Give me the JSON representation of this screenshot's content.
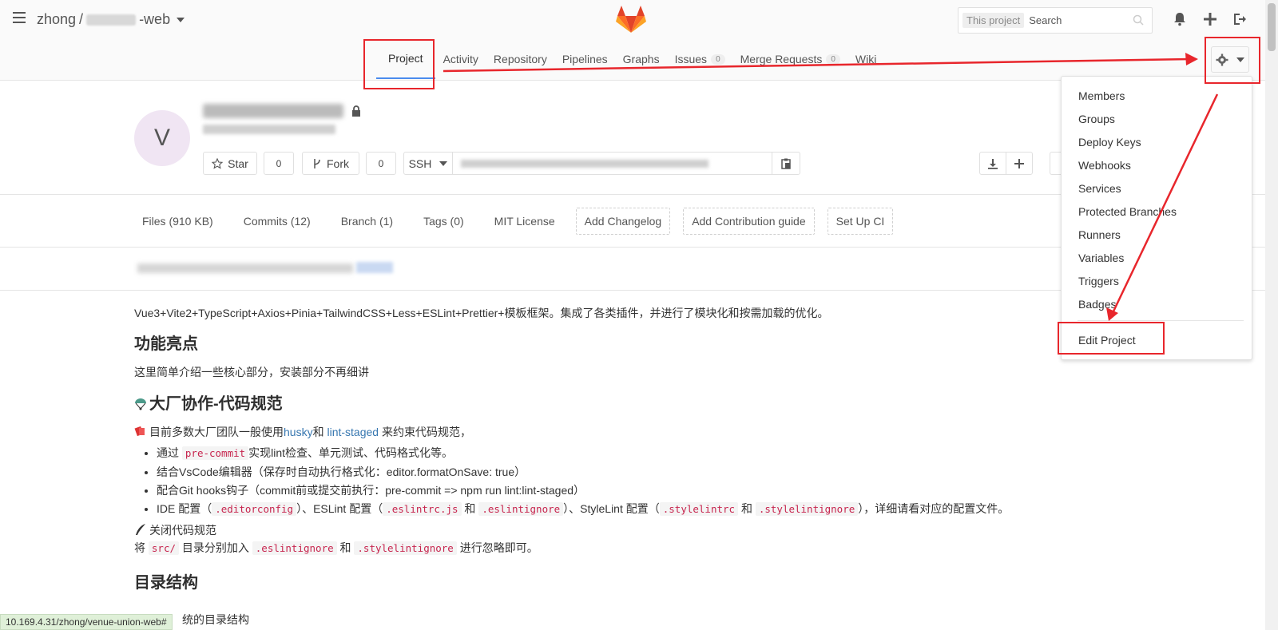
{
  "header": {
    "breadcrumb_user": "zhong",
    "breadcrumb_separator": "/",
    "breadcrumb_project_suffix": "-web",
    "search_scope": "This project",
    "search_placeholder": "Search"
  },
  "nav": {
    "tabs": [
      {
        "label": "Project"
      },
      {
        "label": "Activity"
      },
      {
        "label": "Repository"
      },
      {
        "label": "Pipelines"
      },
      {
        "label": "Graphs"
      },
      {
        "label": "Issues",
        "count": "0"
      },
      {
        "label": "Merge Requests",
        "count": "0"
      },
      {
        "label": "Wiki"
      }
    ]
  },
  "project": {
    "avatar_letter": "V",
    "star_label": "Star",
    "star_count": "0",
    "fork_label": "Fork",
    "fork_count": "0",
    "clone_protocol": "SSH"
  },
  "stats": {
    "files": "Files (910 KB)",
    "commits": "Commits (12)",
    "branch": "Branch (1)",
    "tags": "Tags (0)",
    "license": "MIT License",
    "add_changelog": "Add Changelog",
    "add_contribution": "Add Contribution guide",
    "setup_ci": "Set Up CI"
  },
  "settings_menu": {
    "items": [
      "Members",
      "Groups",
      "Deploy Keys",
      "Webhooks",
      "Services",
      "Protected Branches",
      "Runners",
      "Variables",
      "Triggers",
      "Badges"
    ],
    "edit_project": "Edit Project"
  },
  "readme": {
    "intro": "Vue3+Vite2+TypeScript+Axios+Pinia+TailwindCSS+Less+ESLint+Prettier+模板框架。集成了各类插件，并进行了模块化和按需加载的优化。",
    "h_highlights": "功能亮点",
    "highlights_text": "这里简单介绍一些核心部分，安装部分不再细讲",
    "h_standards": "大厂协作-代码规范",
    "standards_prefix": "目前多数大厂团队一般使用",
    "link_husky": "husky",
    "and": "和",
    "link_lint_staged": "lint-staged",
    "standards_suffix": "来约束代码规范，",
    "li1_a": "通过",
    "li1_code": "pre-commit",
    "li1_b": "实现lint检查、单元测试、代码格式化等。",
    "li2": "结合VsCode编辑器（保存时自动执行格式化：editor.formatOnSave: true）",
    "li3": "配合Git hooks钩子（commit前或提交前执行：pre-commit => npm run lint:lint-staged）",
    "li4_a": "IDE 配置（",
    "li4_code1": ".editorconfig",
    "li4_b": "）、ESLint 配置（",
    "li4_code2": ".eslintrc.js",
    "li4_c": "和",
    "li4_code3": ".eslintignore",
    "li4_d": "）、StyleLint 配置（",
    "li4_code4": ".stylelintrc",
    "li4_e": "和",
    "li4_code5": ".stylelintignore",
    "li4_f": "），详细请看对应的配置文件。",
    "close_title": "关闭代码规范",
    "close_a": "将",
    "close_code1": "src/",
    "close_b": "目录分别加入",
    "close_code2": ".eslintignore",
    "close_c": "和",
    "close_code3": ".stylelintignore",
    "close_d": "进行忽略即可。",
    "h_structure": "目录结构",
    "structure_tail": "统的目录结构"
  },
  "statusbar": {
    "url": "10.169.4.31/zhong/venue-union-web#"
  },
  "colors": {
    "annotation_red": "#e8262c",
    "active_tab_underline": "#4a8bee",
    "link": "#3777b0"
  }
}
